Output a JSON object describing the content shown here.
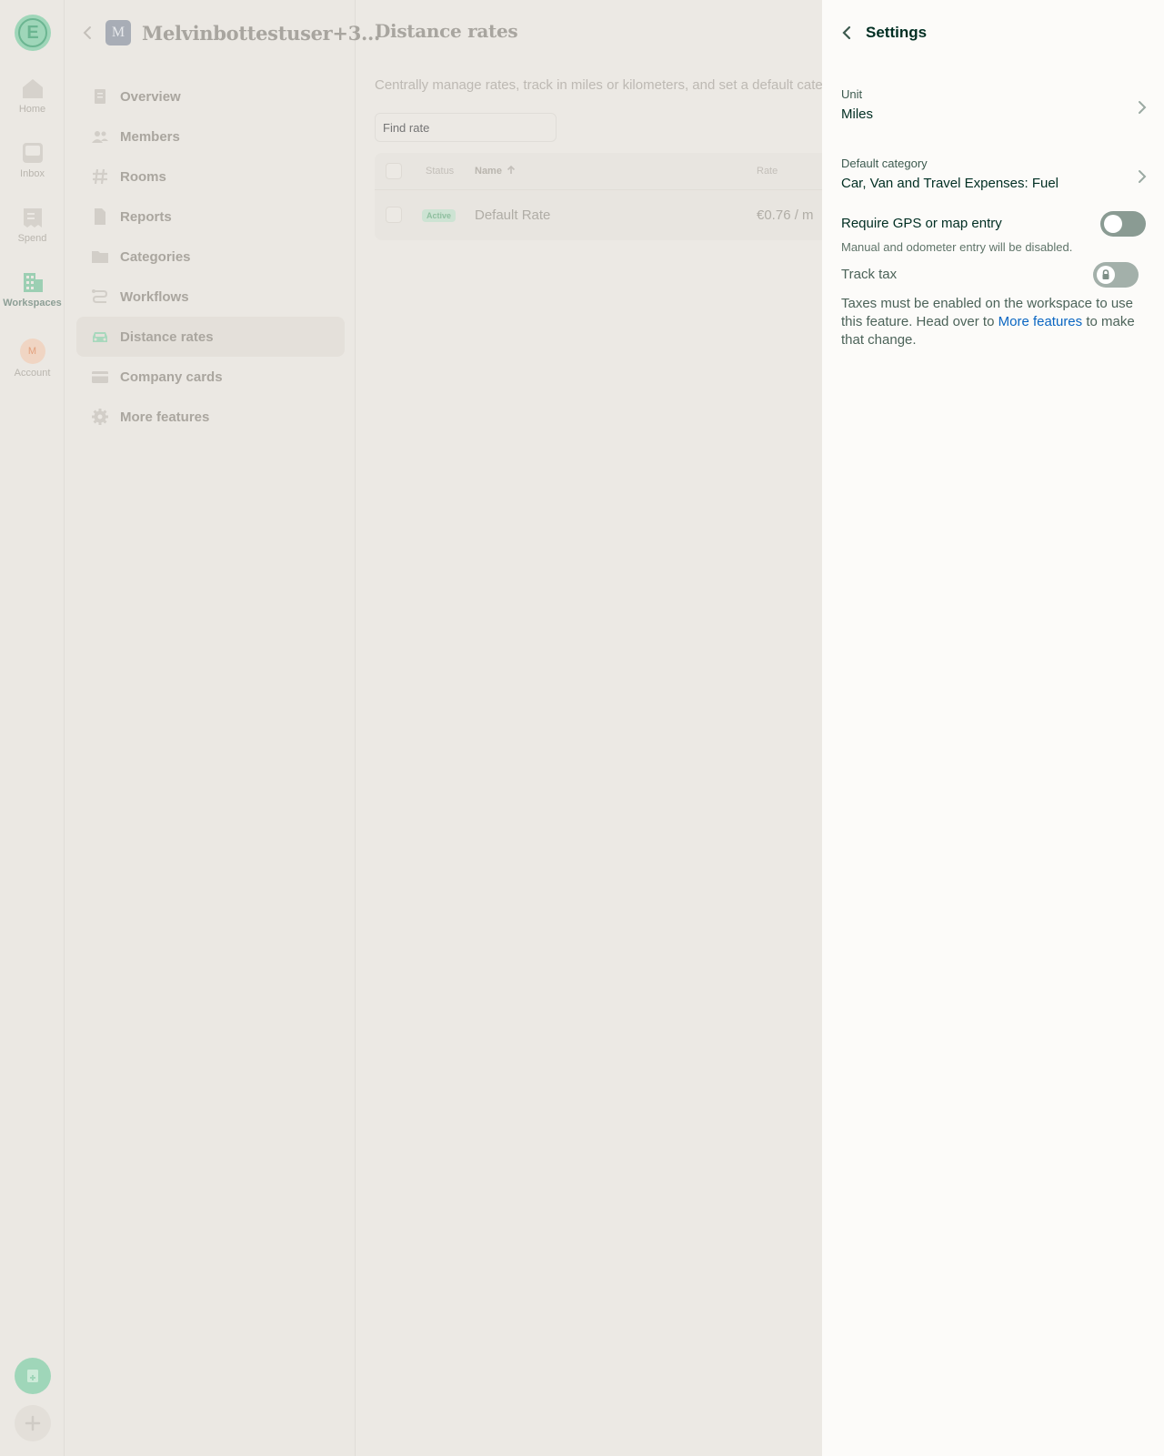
{
  "rail": {
    "logo_letter": "E",
    "items": [
      {
        "label": "Home",
        "icon": "home-icon"
      },
      {
        "label": "Inbox",
        "icon": "inbox-icon"
      },
      {
        "label": "Spend",
        "icon": "receipt-icon"
      },
      {
        "label": "Workspaces",
        "icon": "building-icon",
        "active": true
      },
      {
        "label": "Account",
        "icon": "avatar",
        "avatar_letter": "M"
      }
    ]
  },
  "sidebar": {
    "workspace_initial": "M",
    "workspace_name": "Melvinbottestuser+3...",
    "items": [
      {
        "label": "Overview",
        "icon": "document-icon"
      },
      {
        "label": "Members",
        "icon": "users-icon"
      },
      {
        "label": "Rooms",
        "icon": "hashtag-icon"
      },
      {
        "label": "Reports",
        "icon": "report-icon"
      },
      {
        "label": "Categories",
        "icon": "folder-icon"
      },
      {
        "label": "Workflows",
        "icon": "workflow-icon"
      },
      {
        "label": "Distance rates",
        "icon": "car-icon",
        "active": true
      },
      {
        "label": "Company cards",
        "icon": "credit-card-icon"
      },
      {
        "label": "More features",
        "icon": "gear-icon"
      }
    ]
  },
  "content": {
    "title": "Distance rates",
    "description": "Centrally manage rates, track in miles or kilometers, and set a default categ",
    "search_placeholder": "Find rate",
    "columns": {
      "status": "Status",
      "name": "Name",
      "rate": "Rate"
    },
    "rows": [
      {
        "status": "Active",
        "name": "Default Rate",
        "rate": "€0.76 / m"
      }
    ]
  },
  "panel": {
    "title": "Settings",
    "unit": {
      "label": "Unit",
      "value": "Miles"
    },
    "default_category": {
      "label": "Default category",
      "value": "Car, Van and Travel Expenses: Fuel"
    },
    "gps": {
      "label": "Require GPS or map entry",
      "hint": "Manual and odometer entry will be disabled.",
      "enabled": false
    },
    "track_tax": {
      "label": "Track tax",
      "enabled": false,
      "locked": true
    },
    "note": {
      "prefix": "Taxes must be enabled on the workspace to use this feature. Head over to ",
      "link": "More features",
      "suffix": " to make that change."
    }
  },
  "colors": {
    "accent_green": "#9fd6b9",
    "link_blue": "#0a66c2",
    "toggle_off": "#8a9b93"
  }
}
